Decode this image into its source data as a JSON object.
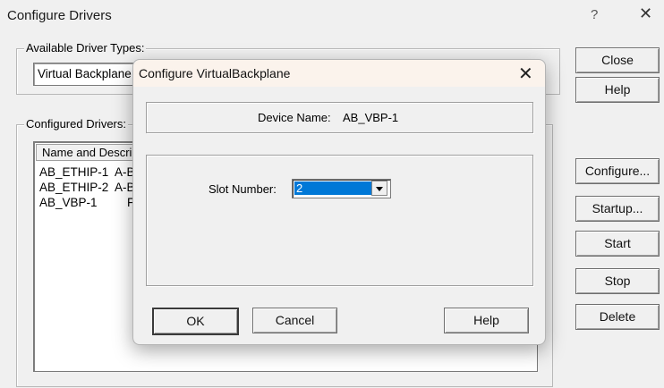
{
  "window": {
    "title": "Configure Drivers",
    "help_glyph": "?",
    "close_glyph": "✕"
  },
  "available": {
    "label": "Available Driver Types:",
    "selected": "Virtual Backplane"
  },
  "configured": {
    "label": "Configured Drivers:",
    "header": "Name and Description",
    "rows": [
      {
        "name": "AB_ETHIP-1",
        "desc": "A-B"
      },
      {
        "name": "AB_ETHIP-2",
        "desc": "A-B"
      },
      {
        "name": "AB_VBP-1",
        "desc": "F"
      }
    ]
  },
  "side_buttons": {
    "close": "Close",
    "help": "Help",
    "configure": "Configure...",
    "startup": "Startup...",
    "start": "Start",
    "stop": "Stop",
    "delete": "Delete"
  },
  "dialog": {
    "title": "Configure VirtualBackplane",
    "close_glyph": "✕",
    "device_name_label": "Device Name:",
    "device_name_value": "AB_VBP-1",
    "slot_label": "Slot Number:",
    "slot_value": "2",
    "ok": "OK",
    "cancel": "Cancel",
    "help": "Help"
  }
}
